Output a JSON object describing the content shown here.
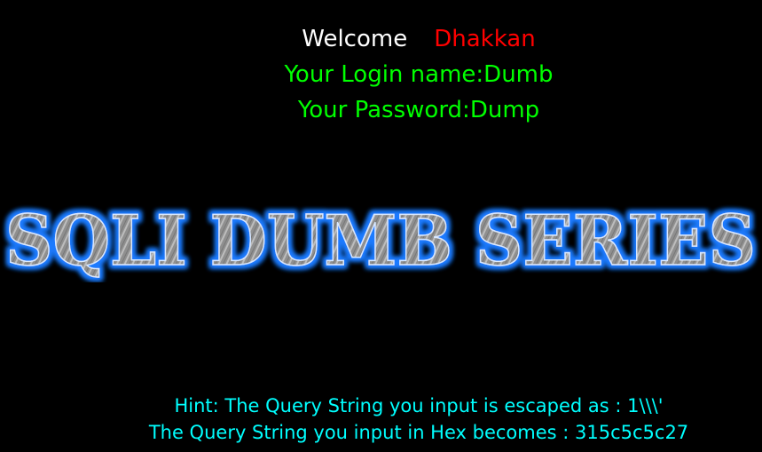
{
  "welcome": {
    "label": "Welcome",
    "user": "Dhakkan"
  },
  "login": {
    "name_line": "Your Login name:Dumb",
    "password_line": "Your Password:Dump"
  },
  "logo": {
    "text": "SQLI DUMB SERIES"
  },
  "hint": {
    "escaped_line": "Hint: The Query String you input is escaped as : 1\\\\\\'",
    "hex_line": "The Query String you input in Hex becomes : 315c5c5c27"
  },
  "colors": {
    "background": "#000000",
    "green": "#00ff00",
    "red": "#ff0000",
    "cyan": "#00ffff"
  }
}
